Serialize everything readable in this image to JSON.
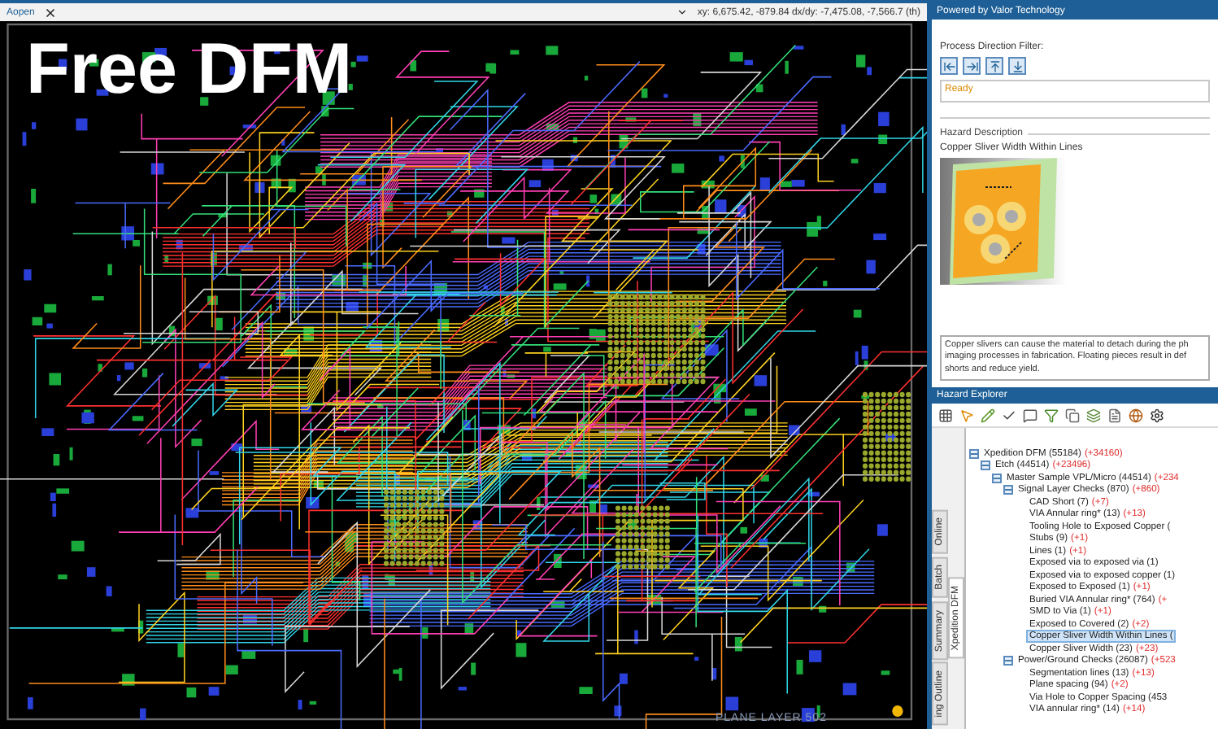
{
  "top_bar": {
    "tab_label": "Aopen",
    "coordinates": "xy: 6,675.42, -879.84  dx/dy: -7,475.08, -7,566.7  (th)"
  },
  "banner": "Free DFM",
  "layer_label": "PLANE LAYER 502",
  "side_panel": {
    "title": "Powered by Valor Technology",
    "filter_label": "Process Direction Filter:",
    "status": "Ready",
    "hazard_description": {
      "heading": "Hazard Description",
      "name": "Copper Sliver Width Within Lines",
      "text": "Copper slivers can cause the material to detach during the ph imaging processes in fabrication. Floating pieces result in def shorts and reduce yield."
    }
  },
  "hazard_explorer": {
    "title": "Hazard Explorer",
    "tabs": [
      {
        "label": "Online",
        "selected": false
      },
      {
        "label": "Batch",
        "selected": false
      },
      {
        "label": "Xpedition DFM",
        "selected": true
      },
      {
        "label": "Summary",
        "selected": false
      },
      {
        "label": "ing Outline",
        "selected": false
      }
    ],
    "tree": [
      {
        "label": "Xpedition DFM (55184)",
        "delta": "(+34160)",
        "expanded": true,
        "selected": false,
        "children": [
          {
            "label": "Etch (44514)",
            "delta": "(+23496)",
            "expanded": true,
            "selected": false,
            "children": [
              {
                "label": "Master Sample VPL/Micro (44514)",
                "delta": "(+234",
                "expanded": true,
                "selected": false,
                "children": [
                  {
                    "label": "Signal Layer Checks (870)",
                    "delta": "(+860)",
                    "expanded": true,
                    "selected": false,
                    "children": [
                      {
                        "label": "CAD Short (7)",
                        "delta": "(+7)",
                        "selected": false
                      },
                      {
                        "label": "VIA Annular ring* (13)",
                        "delta": "(+13)",
                        "selected": false
                      },
                      {
                        "label": "Tooling Hole to Exposed Copper (",
                        "selected": false
                      },
                      {
                        "label": "Stubs (9)",
                        "delta": "(+1)",
                        "selected": false
                      },
                      {
                        "label": "Lines (1)",
                        "delta": "(+1)",
                        "selected": false
                      },
                      {
                        "label": "Exposed via to exposed via (1)",
                        "selected": false
                      },
                      {
                        "label": "Exposed via to exposed copper (1)",
                        "selected": false
                      },
                      {
                        "label": "Exposed to Exposed (1)",
                        "delta": "(+1)",
                        "selected": false
                      },
                      {
                        "label": "Buried VIA Annular ring* (764)",
                        "delta": "(+",
                        "selected": false
                      },
                      {
                        "label": "SMD to Via (1)",
                        "delta": "(+1)",
                        "selected": false
                      },
                      {
                        "label": "Exposed to Covered (2)",
                        "delta": "(+2)",
                        "selected": false
                      },
                      {
                        "label": "Copper Sliver Width Within Lines (",
                        "selected": true
                      },
                      {
                        "label": "Copper Sliver Width (23)",
                        "delta": "(+23)",
                        "selected": false
                      }
                    ]
                  },
                  {
                    "label": "Power/Ground Checks (26087)",
                    "delta": "(+523",
                    "expanded": true,
                    "selected": false,
                    "children": [
                      {
                        "label": "Segmentation lines (13)",
                        "delta": "(+13)",
                        "selected": false
                      },
                      {
                        "label": "Plane spacing (94)",
                        "delta": "(+2)",
                        "selected": false
                      },
                      {
                        "label": "Via Hole to Copper Spacing (453",
                        "selected": false
                      },
                      {
                        "label": "VIA annular ring* (14)",
                        "delta": "(+14)",
                        "selected": false
                      }
                    ]
                  }
                ]
              }
            ]
          }
        ]
      }
    ]
  }
}
